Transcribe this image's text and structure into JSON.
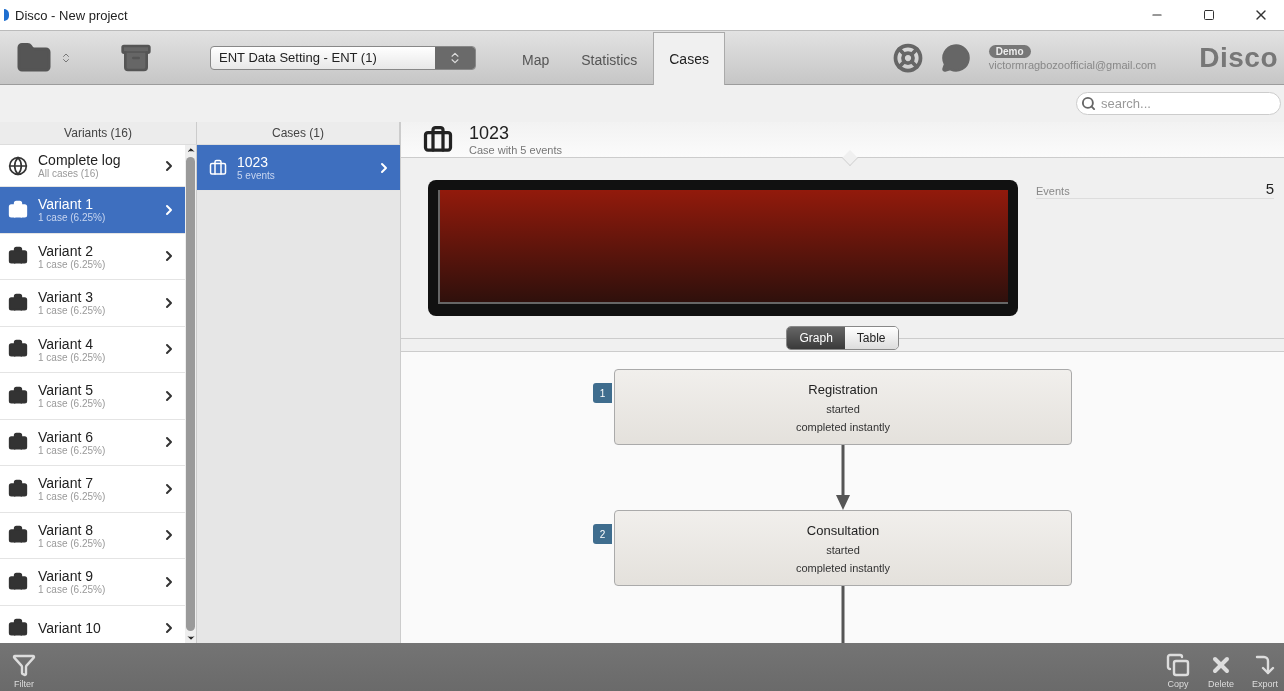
{
  "window": {
    "title": "Disco - New project"
  },
  "toolbar": {
    "dataset": "ENT Data Setting - ENT (1)",
    "tabs": [
      {
        "label": "Map",
        "selected": false
      },
      {
        "label": "Statistics",
        "selected": false
      },
      {
        "label": "Cases",
        "selected": true
      }
    ],
    "account": {
      "badge": "Demo",
      "email": "victormragbozoofficial@gmail.com"
    },
    "logo": "Disco"
  },
  "search": {
    "placeholder": "search..."
  },
  "variants": {
    "header": "Variants (16)",
    "items": [
      {
        "kind": "log",
        "title": "Complete log",
        "subtitle": "All cases (16)",
        "selected": false
      },
      {
        "kind": "variant",
        "title": "Variant 1",
        "subtitle": "1 case (6.25%)",
        "selected": true
      },
      {
        "kind": "variant",
        "title": "Variant 2",
        "subtitle": "1 case (6.25%)",
        "selected": false
      },
      {
        "kind": "variant",
        "title": "Variant 3",
        "subtitle": "1 case (6.25%)",
        "selected": false
      },
      {
        "kind": "variant",
        "title": "Variant 4",
        "subtitle": "1 case (6.25%)",
        "selected": false
      },
      {
        "kind": "variant",
        "title": "Variant 5",
        "subtitle": "1 case (6.25%)",
        "selected": false
      },
      {
        "kind": "variant",
        "title": "Variant 6",
        "subtitle": "1 case (6.25%)",
        "selected": false
      },
      {
        "kind": "variant",
        "title": "Variant 7",
        "subtitle": "1 case (6.25%)",
        "selected": false
      },
      {
        "kind": "variant",
        "title": "Variant 8",
        "subtitle": "1 case (6.25%)",
        "selected": false
      },
      {
        "kind": "variant",
        "title": "Variant 9",
        "subtitle": "1 case (6.25%)",
        "selected": false
      },
      {
        "kind": "variant",
        "title": "Variant 10",
        "selected": false
      }
    ]
  },
  "cases": {
    "header": "Cases (1)",
    "items": [
      {
        "title": "1023",
        "subtitle": "5 events",
        "selected": true
      }
    ]
  },
  "detail": {
    "title": "1023",
    "subtitle": "Case with 5 events",
    "stats": [
      {
        "label": "Events",
        "value": "5"
      }
    ],
    "view_toggle": [
      {
        "label": "Graph",
        "selected": true
      },
      {
        "label": "Table",
        "selected": false
      }
    ],
    "events": [
      {
        "number": "1",
        "name": "Registration",
        "lines": [
          "started",
          "completed instantly"
        ]
      },
      {
        "number": "2",
        "name": "Consultation",
        "lines": [
          "started",
          "completed instantly"
        ]
      }
    ]
  },
  "bottom_bar": {
    "actions": [
      {
        "kind": "filter",
        "label": "Filter"
      },
      {
        "kind": "copy",
        "label": "Copy"
      },
      {
        "kind": "delete",
        "label": "Delete"
      },
      {
        "kind": "export",
        "label": "Export"
      }
    ]
  }
}
